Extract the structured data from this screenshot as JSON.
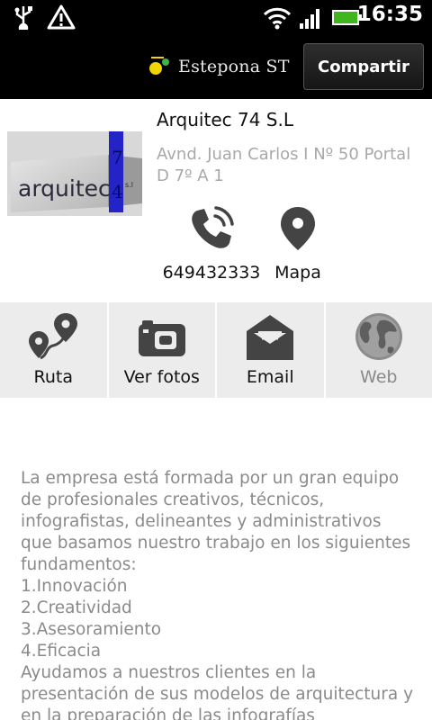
{
  "status_bar": {
    "time": "16:35",
    "icons": [
      "usb-icon",
      "warning-icon",
      "wifi-icon",
      "signal-icon",
      "battery-icon"
    ]
  },
  "title_bar": {
    "brand": "Estepona ST",
    "share_label": "Compartir"
  },
  "company": {
    "name": "Arquitec 74 S.L",
    "address": "Avnd. Juan Carlos I Nº 50 Portal D 7º A 1",
    "logo_text": "arquitec",
    "logo_digits": [
      "7",
      "4"
    ],
    "logo_suffix": "s.l"
  },
  "contacts": [
    {
      "label": "649432333",
      "icon": "phone-icon"
    },
    {
      "label": "Mapa",
      "icon": "map-pin-icon"
    }
  ],
  "actions": [
    {
      "label": "Ruta",
      "icon": "route-icon"
    },
    {
      "label": "Ver fotos",
      "icon": "camera-icon"
    },
    {
      "label": "Email",
      "icon": "email-icon"
    },
    {
      "label": "Web",
      "icon": "globe-icon"
    }
  ],
  "description": "La empresa está formada por un gran equipo de profesionales creativos, técnicos, infografistas, delineantes y administrativos que basamos nuestro trabajo en los siguientes fundamentos:\n1.Innovación\n2.Creatividad\n3.Asesoramiento\n4.Eficacia\nAyudamos a nuestros clientes en la presentación de sus modelos de arquitectura y en la preparación de las infografías",
  "colors": {
    "bar_background": "#000000",
    "action_background": "#ececec",
    "icon_dark": "#444444",
    "muted_text": "#8a8a8a",
    "address_text": "#a8a8a8",
    "logo_blue": "#2323c8"
  }
}
